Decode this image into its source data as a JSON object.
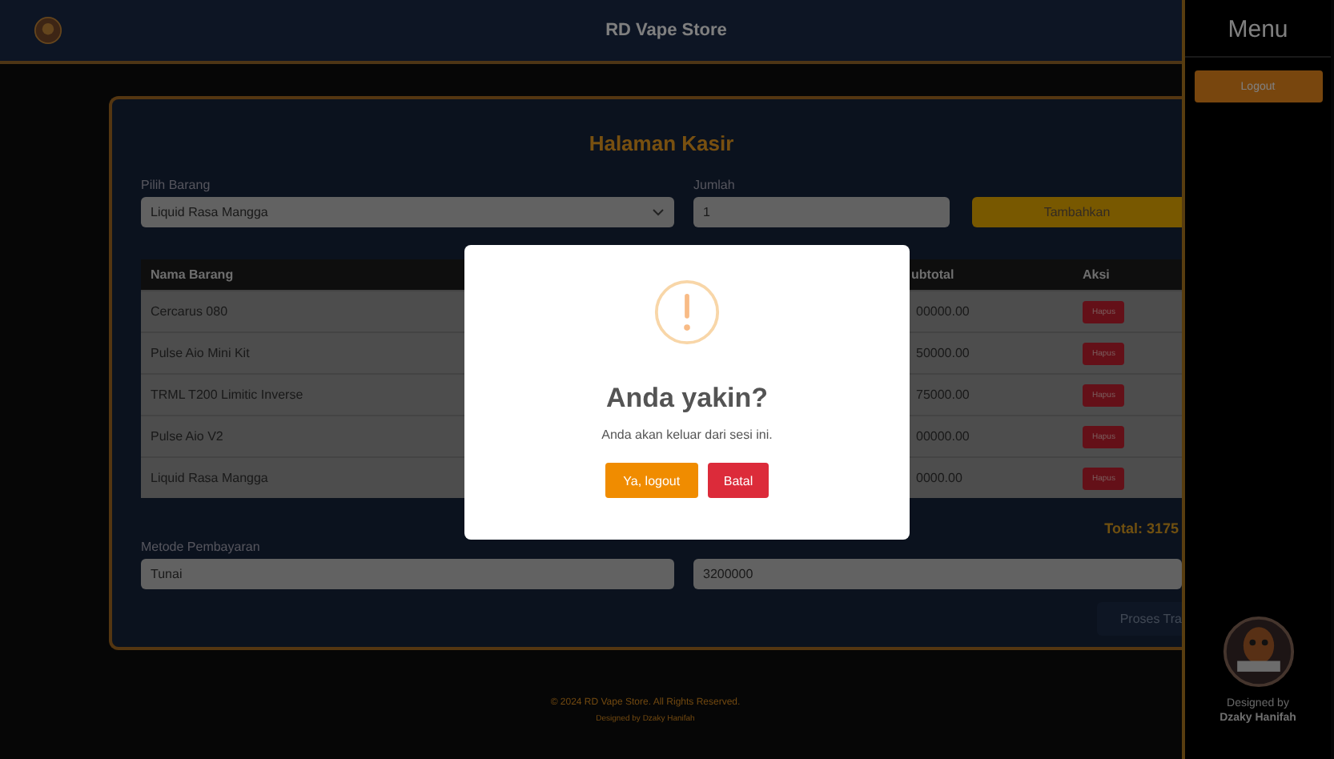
{
  "header": {
    "title": "RD Vape Store"
  },
  "sidebar": {
    "title": "Menu",
    "logout_button": "Logout",
    "credit_line_1": "Designed by",
    "credit_line_2": "Dzaky Hanifah"
  },
  "page": {
    "title": "Halaman Kasir",
    "item_field": {
      "label": "Pilih Barang",
      "value": "Liquid Rasa Mangga"
    },
    "quantity_field": {
      "label": "Jumlah",
      "value": "1"
    },
    "add_button": "Tambahkan",
    "table": {
      "columns": [
        "Nama Barang",
        "ubtotal",
        "Aksi"
      ],
      "rows": [
        {
          "name": "Cercarus 080",
          "subtotal": "00000.00",
          "action": "Hapus"
        },
        {
          "name": "Pulse Aio Mini Kit",
          "subtotal": "50000.00",
          "action": "Hapus"
        },
        {
          "name": "TRML T200 Limitic Inverse",
          "subtotal": "75000.00",
          "action": "Hapus"
        },
        {
          "name": "Pulse Aio V2",
          "subtotal": "00000.00",
          "action": "Hapus"
        },
        {
          "name": "Liquid Rasa Mangga",
          "subtotal": "0000.00",
          "action": "Hapus"
        }
      ]
    },
    "total": "Total: 3175",
    "payment_field": {
      "label": "Metode Pembayaran",
      "value": "Tunai"
    },
    "amount_field": {
      "value": "3200000"
    },
    "process_button": "Proses Tra"
  },
  "footer": {
    "copyright": "© 2024 RD Vape Store. All Rights Reserved.",
    "credit": "Designed by Dzaky Hanifah"
  },
  "dialog": {
    "title": "Anda yakin?",
    "message": "Anda akan keluar dari sesi ini.",
    "confirm_button": "Ya, logout",
    "cancel_button": "Batal"
  }
}
